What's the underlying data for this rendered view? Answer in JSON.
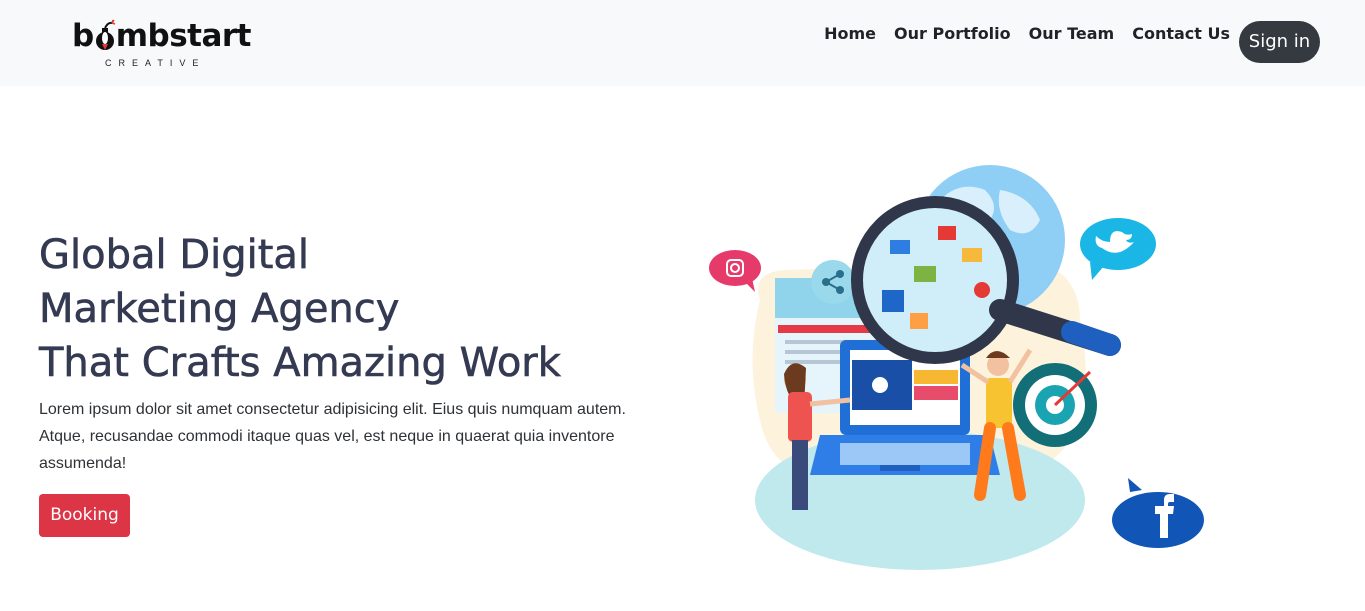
{
  "brand": {
    "name_prefix": "b",
    "name_suffix": "mbstart",
    "tagline": "CREATIVE",
    "logo_icon": "bomb-icon"
  },
  "nav": {
    "links": [
      {
        "label": "Home"
      },
      {
        "label": "Our Portfolio"
      },
      {
        "label": "Our Team"
      },
      {
        "label": "Contact Us"
      }
    ],
    "signin_label": "Sign in"
  },
  "hero": {
    "title_lines": [
      "Global Digital",
      "Marketing Agency",
      "That Crafts Amazing Work"
    ],
    "description": "Lorem ipsum dolor sit amet consectetur adipisicing elit. Eius quis numquam autem. Atque, recusandae commodi itaque quas vel, est neque in quaerat quia inventore assumenda!",
    "cta_label": "Booking"
  },
  "illustration": {
    "icons": [
      "instagram-icon",
      "share-icon",
      "twitter-icon",
      "facebook-icon",
      "magnifier-icon",
      "globe-icon",
      "laptop-icon",
      "target-icon"
    ]
  },
  "colors": {
    "navbar_bg": "#f8f9fa",
    "signin_bg": "#343a40",
    "cta_bg": "#dc3545",
    "title": "#343a52"
  }
}
